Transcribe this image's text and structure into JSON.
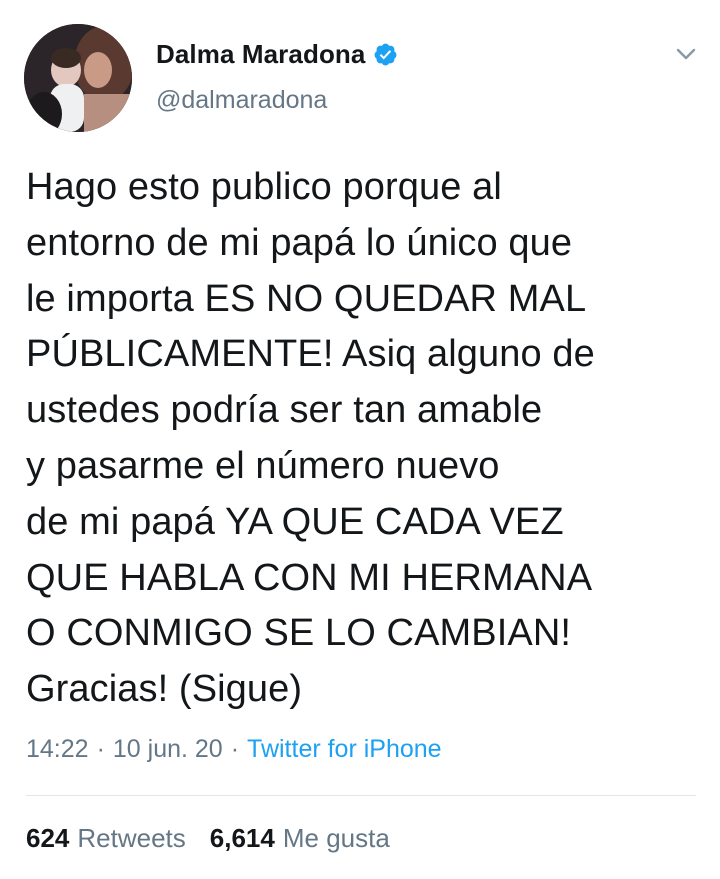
{
  "colors": {
    "text_primary": "#14171a",
    "text_secondary": "#657786",
    "link": "#1da1f2",
    "verified": "#1da1f2",
    "divider": "#e1e8ed"
  },
  "author": {
    "display_name": "Dalma Maradona",
    "handle": "@dalmaradona",
    "verified": true,
    "avatar_icon": "profile-photo"
  },
  "tweet": {
    "lines": [
      "Hago esto publico porque al",
      "entorno de mi papá lo único que",
      "le importa ES NO QUEDAR MAL",
      "PÚBLICAMENTE! Asiq alguno de",
      "ustedes podría ser tan amable",
      "y pasarme el número nuevo",
      "de mi papá YA QUE CADA VEZ",
      "QUE HABLA CON MI HERMANA",
      "O CONMIGO SE LO CAMBIAN!",
      "Gracias! (Sigue)"
    ],
    "time": "14:22",
    "separator": "·",
    "date": "10 jun. 20",
    "source": "Twitter for iPhone"
  },
  "stats": {
    "retweets_count": "624",
    "retweets_label": "Retweets",
    "likes_count": "6,614",
    "likes_label": "Me gusta"
  },
  "icons": {
    "verified": "verified-badge-icon",
    "menu": "chevron-down-icon"
  }
}
